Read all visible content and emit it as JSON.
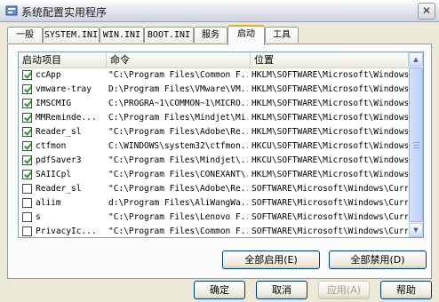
{
  "window": {
    "title": "系统配置实用程序",
    "close_glyph": "✕"
  },
  "tabs": [
    {
      "label": "一般",
      "active": false
    },
    {
      "label": "SYSTEM.INI",
      "active": false
    },
    {
      "label": "WIN.INI",
      "active": false
    },
    {
      "label": "BOOT.INI",
      "active": false
    },
    {
      "label": "服务",
      "active": false
    },
    {
      "label": "启动",
      "active": true
    },
    {
      "label": "工具",
      "active": false
    }
  ],
  "startup_list": {
    "columns": [
      "启动项目",
      "命令",
      "位置"
    ],
    "rows": [
      {
        "checked": true,
        "name": "ccApp",
        "command": "\"C:\\Program Files\\Common F...",
        "location": "HKLM\\SOFTWARE\\Microsoft\\Windows\\Curre"
      },
      {
        "checked": true,
        "name": "vmware-tray",
        "command": "D:\\Program Files\\VMware\\VM...",
        "location": "HKLM\\SOFTWARE\\Microsoft\\Windows\\Curre"
      },
      {
        "checked": true,
        "name": "IMSCMIG",
        "command": "C:\\PROGRA~1\\COMMON~1\\MICRO...",
        "location": "HKLM\\SOFTWARE\\Microsoft\\Windows\\Curre"
      },
      {
        "checked": true,
        "name": "MMReminde...",
        "command": "C:\\Program Files\\Mindjet\\Mi...",
        "location": "HKLM\\SOFTWARE\\Microsoft\\Windows\\Curre"
      },
      {
        "checked": true,
        "name": "Reader_sl",
        "command": "\"C:\\Program Files\\Adobe\\Re...",
        "location": "HKLM\\SOFTWARE\\Microsoft\\Windows\\Curre"
      },
      {
        "checked": true,
        "name": "ctfmon",
        "command": "C:\\WINDOWS\\system32\\ctfmon...",
        "location": "HKCU\\SOFTWARE\\Microsoft\\Windows\\Curre"
      },
      {
        "checked": true,
        "name": "pdfSaver3",
        "command": "\"C:\\Program Files\\Mindjet\\...",
        "location": "HKCU\\SOFTWARE\\Microsoft\\Windows\\Curre"
      },
      {
        "checked": true,
        "name": "SAIICpl",
        "command": "\"C:\\Program Files\\CONEXANT\\...",
        "location": "HKLM\\SOFTWARE\\Microsoft\\Windows\\Curre"
      },
      {
        "checked": false,
        "name": "Reader_sl",
        "command": "\"C:\\Program Files\\Adobe\\Re...",
        "location": "SOFTWARE\\Microsoft\\Windows\\CurrentVer"
      },
      {
        "checked": false,
        "name": "aliim",
        "command": "d:\\Program Files\\AliWangWa...",
        "location": "SOFTWARE\\Microsoft\\Windows\\CurrentVer"
      },
      {
        "checked": false,
        "name": "s",
        "command": "\"C:\\Program Files\\Lenovo F...",
        "location": "SOFTWARE\\Microsoft\\Windows\\CurrentVer"
      },
      {
        "checked": false,
        "name": "PrivacyIc...",
        "command": "\"C:\\Program Files\\Common F...",
        "location": "SOFTWARE\\Microsoft\\Windows\\CurrentVer"
      }
    ]
  },
  "scroll": {
    "up_glyph": "▲",
    "down_glyph": "▼"
  },
  "panel_buttons": {
    "enable_all": "全部启用(E)",
    "disable_all": "全部禁用(D)"
  },
  "dialog_buttons": {
    "ok": "确定",
    "cancel": "取消",
    "apply": "应用(A)",
    "help": "帮助"
  }
}
